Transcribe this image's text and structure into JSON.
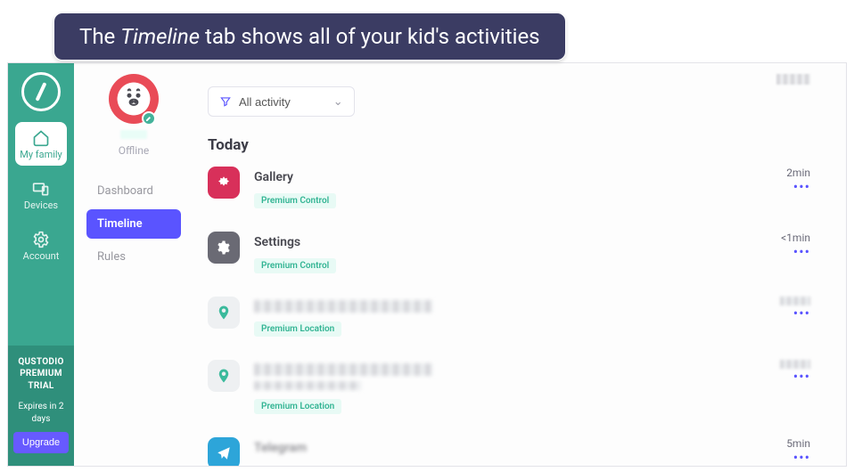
{
  "caption": {
    "pre": "The ",
    "em": "Timeline",
    "post": " tab shows all of your kid's activities"
  },
  "rail": {
    "items": [
      {
        "label": "My family",
        "icon": "home-icon"
      },
      {
        "label": "Devices",
        "icon": "devices-icon"
      },
      {
        "label": "Account",
        "icon": "gear-icon"
      }
    ],
    "promo": {
      "title": "QUSTODIO PREMIUM TRIAL",
      "expires": "Expires in 2 days",
      "upgrade": "Upgrade"
    }
  },
  "profile": {
    "status": "Offline",
    "nav": [
      {
        "label": "Dashboard"
      },
      {
        "label": "Timeline"
      },
      {
        "label": "Rules"
      }
    ]
  },
  "filter": {
    "label": "All activity"
  },
  "section_title": "Today",
  "activities": [
    {
      "name": "Gallery",
      "duration": "2min",
      "tag": "Premium Control",
      "kind": "app",
      "icon": "gallery"
    },
    {
      "name": "Settings",
      "duration": "<1min",
      "tag": "Premium Control",
      "kind": "app",
      "icon": "settings"
    },
    {
      "name": "",
      "duration": "",
      "tag": "Premium Location",
      "kind": "location",
      "icon": "loc"
    },
    {
      "name": "",
      "duration": "",
      "tag": "Premium Location",
      "kind": "location",
      "icon": "loc"
    },
    {
      "name": "Telegram",
      "duration": "5min",
      "tag": "",
      "kind": "app",
      "icon": "telegram"
    }
  ]
}
